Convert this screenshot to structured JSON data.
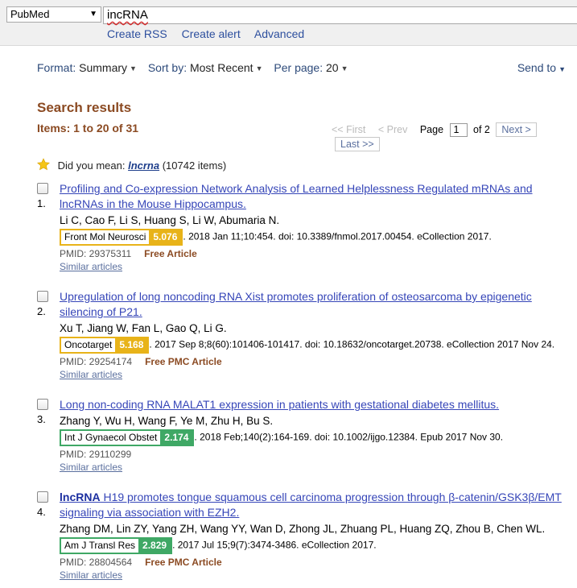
{
  "search": {
    "database": "PubMed",
    "query": "incRNA",
    "links": [
      "Create RSS",
      "Create alert",
      "Advanced"
    ]
  },
  "toolbar": {
    "format_label": "Format",
    "format_value": "Summary",
    "sort_label": "Sort by",
    "sort_value": "Most Recent",
    "perpage_label": "Per page",
    "perpage_value": "20",
    "send_to": "Send to"
  },
  "results_header": {
    "title": "Search results",
    "items_count": "Items: 1 to 20 of 31"
  },
  "pager": {
    "first": "<< First",
    "prev": "< Prev",
    "page_label": "Page",
    "page_value": "1",
    "of": "of 2",
    "next": "Next >",
    "last": "Last >>"
  },
  "did_you_mean": {
    "prefix": "Did you mean:",
    "term": "lncrna",
    "count": "(10742 items)"
  },
  "colors": {
    "impact_yellow": "#e8b319",
    "impact_green": "#3fa865",
    "title_link": "#3646b8",
    "accent_brown": "#8b4a22"
  },
  "results": [
    {
      "num": "1.",
      "title_bold": "",
      "title": "Profiling and Co-expression Network Analysis of Learned Helplessness Regulated mRNAs and lncRNAs in the Mouse Hippocampus.",
      "authors": "Li C, Cao F, Li S, Huang S, Li W, Abumaria N.",
      "journal": "Front Mol Neurosci",
      "impact": "5.076",
      "impact_color": "#e8b319",
      "citation": ". 2018 Jan 11;10:454. doi: 10.3389/fnmol.2017.00454. eCollection 2017.",
      "pmid": "PMID: 29375311",
      "free": "Free Article",
      "similar": "Similar articles"
    },
    {
      "num": "2.",
      "title_bold": "",
      "title": "Upregulation of long noncoding RNA Xist promotes proliferation of osteosarcoma by epigenetic silencing of P21.",
      "authors": "Xu T, Jiang W, Fan L, Gao Q, Li G.",
      "journal": "Oncotarget",
      "impact": "5.168",
      "impact_color": "#e8b319",
      "citation": ". 2017 Sep 8;8(60):101406-101417. doi: 10.18632/oncotarget.20738. eCollection 2017 Nov 24.",
      "pmid": "PMID: 29254174",
      "free": "Free PMC Article",
      "similar": "Similar articles"
    },
    {
      "num": "3.",
      "title_bold": "",
      "title": "Long non-coding RNA MALAT1 expression in patients with gestational diabetes mellitus.",
      "authors": "Zhang Y, Wu H, Wang F, Ye M, Zhu H, Bu S.",
      "journal": "Int J Gynaecol Obstet",
      "impact": "2.174",
      "impact_color": "#3fa865",
      "citation": ". 2018 Feb;140(2):164-169. doi: 10.1002/ijgo.12384. Epub 2017 Nov 30.",
      "pmid": "PMID: 29110299",
      "free": "",
      "similar": "Similar articles"
    },
    {
      "num": "4.",
      "title_bold": "lncRNA",
      "title": " H19 promotes tongue squamous cell carcinoma progression through β-catenin/GSK3β/EMT signaling via association with EZH2.",
      "authors": "Zhang DM, Lin ZY, Yang ZH, Wang YY, Wan D, Zhong JL, Zhuang PL, Huang ZQ, Zhou B, Chen WL.",
      "journal": "Am J Transl Res",
      "impact": "2.829",
      "impact_color": "#3fa865",
      "citation": ". 2017 Jul 15;9(7):3474-3486. eCollection 2017.",
      "pmid": "PMID: 28804564",
      "free": "Free PMC Article",
      "similar": "Similar articles"
    }
  ]
}
